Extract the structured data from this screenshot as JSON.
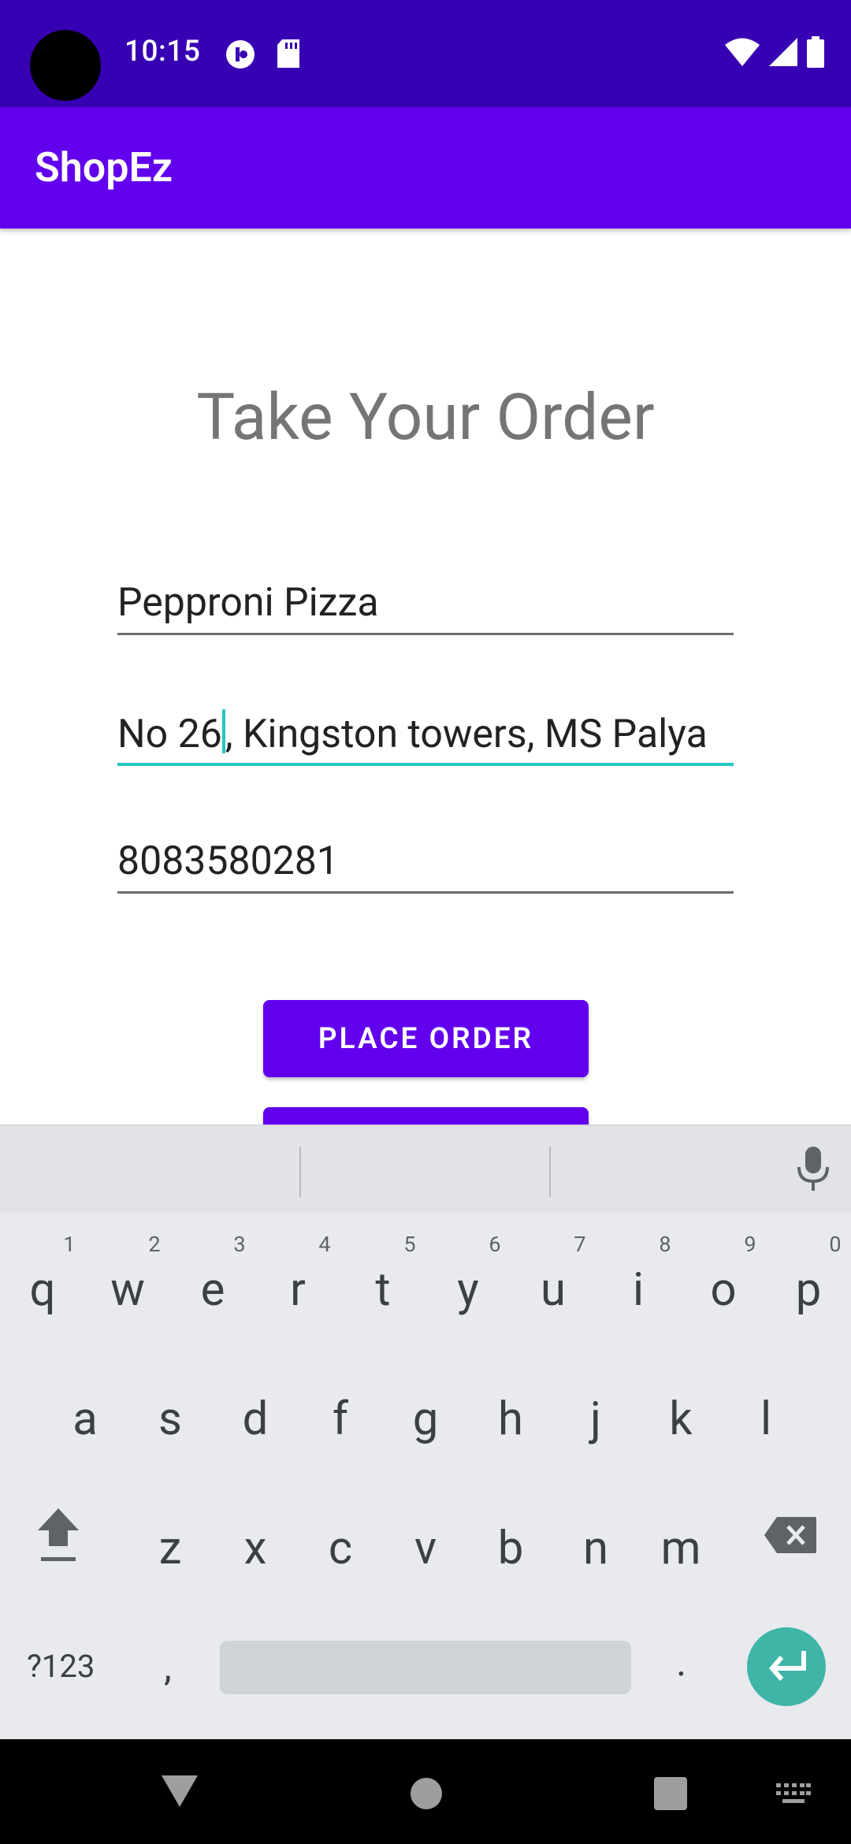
{
  "status_bar": {
    "time": "10:15",
    "icons_left": [
      "vpn-icon",
      "sd-card-icon"
    ],
    "icons_right": [
      "wifi-icon",
      "cell-signal-icon",
      "battery-icon"
    ]
  },
  "app_bar": {
    "title": "ShopEz"
  },
  "page": {
    "title": "Take Your Order",
    "fields": [
      {
        "name": "item",
        "value": "Peppronì Pizza"
      },
      {
        "name": "address",
        "value_before_cursor": "No 26",
        "value_after_cursor": ", Kingston towers, MS Palya"
      },
      {
        "name": "phone",
        "value": "8083580281"
      }
    ],
    "place_order_label": "PLACE ORDER"
  },
  "keyboard": {
    "row1": [
      "q",
      "w",
      "e",
      "r",
      "t",
      "y",
      "u",
      "i",
      "o",
      "p"
    ],
    "row1_hints": [
      "1",
      "2",
      "3",
      "4",
      "5",
      "6",
      "7",
      "8",
      "9",
      "0"
    ],
    "row2": [
      "a",
      "s",
      "d",
      "f",
      "g",
      "h",
      "j",
      "k",
      "l"
    ],
    "row3": [
      "z",
      "x",
      "c",
      "v",
      "b",
      "n",
      "m"
    ],
    "symbols_label": "?123",
    "comma": ",",
    "period": "."
  },
  "colors": {
    "status_bar": "#3700b3",
    "app_bar": "#6200ee",
    "accent": "#26c6c0",
    "enter_key": "#3fb5a8"
  }
}
